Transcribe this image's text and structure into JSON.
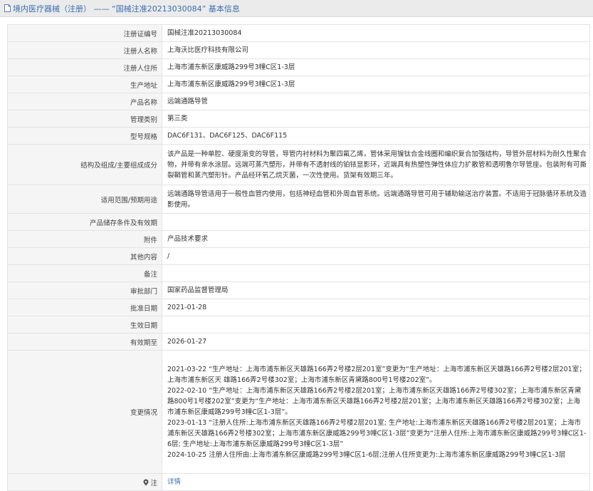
{
  "header": {
    "title": "境内医疗器械（注册） —— “国械注准20213030084” 基本信息"
  },
  "rows": [
    {
      "label": "注册证编号",
      "value": "国械注准20213030084"
    },
    {
      "label": "注册人名称",
      "value": "上海沃比医疗科技有限公司"
    },
    {
      "label": "注册人住所",
      "value": "上海市浦东新区康威路299号3幢C区1-3层"
    },
    {
      "label": "生产地址",
      "value": "上海市浦东新区康威路299号3幢C区1-3层"
    },
    {
      "label": "产品名称",
      "value": "远端通路导管"
    },
    {
      "label": "管理类别",
      "value": "第三类"
    },
    {
      "label": "型号规格",
      "value": "DAC6F131、DAC6F125、DAC6F115"
    },
    {
      "label": "结构及组成/主要组成成分",
      "value": "该产品是一种单腔、硬度渐变的导管，导管内衬材料为聚四氟乙烯，管体采用镍钛合金线圈和编织复合加强结构，导管外层材料为耐久性聚合物，并带有亲水涂层。远端可蒸汽塑形，并带有不透射线的铂铱显影环，近端具有热塑性弹性体应力扩散管和透明鲁尔导管座。包装附有可撕裂鞘管和蒸汽塑形针。产品经环氧乙烷灭菌，一次性使用。货架有效期三年。"
    },
    {
      "label": "适用范围/预期用途",
      "value": "远端通路导管适用于一般性血管内使用，包括神经血管和外周血管系统。远端通路导管可用于辅助输送治疗装置。不适用于冠脉循环系统及造影使用。"
    },
    {
      "label": "产品储存条件及有效期",
      "value": ""
    },
    {
      "label": "附件",
      "value": "产品技术要求"
    },
    {
      "label": "其他内容",
      "value": "/"
    },
    {
      "label": "备注",
      "value": ""
    },
    {
      "label": "审批部门",
      "value": "国家药品监督管理局"
    },
    {
      "label": "批准日期",
      "value": "2021-01-28"
    },
    {
      "label": "生效日期",
      "value": ""
    },
    {
      "label": "有效期至",
      "value": "2026-01-27"
    }
  ],
  "changes": {
    "label": "变更情况",
    "lines": [
      "2021-03-22 “生产地址：上海市浦东新区天雄路166弄2号楼2层201室”变更为“生产地址：上海市浦东新区天雄路166弄2号楼2层201室；上海市浦东新区天 雄路166弄2号楼302室；上海市浦东新区青黛路800号1号楼202室”。",
      "2022-02-10 “生产地址：上海市浦东新区天雄路166弄2号楼2层201室；上海市浦东新区天雄路166弄2号楼302室；上海市浦东新区青黛路800号1号楼202室”变更为“生产地址：上海市浦东新区天雄路166弄2号楼2层201室；上海市浦东新区天雄路166弄2号楼302室；上海市浦东新区康威路299号3幢C区1-3层”。",
      "2023-01-13 “注册人住所:上海市浦东新区天雄路166弄2号楼2层201室; 生产地址:上海市浦东新区天雄路166弄2号楼2层201室；上海市浦东新区天雄路166弄2号楼302室；上海市浦东新区康威路299号3幢C区1-3层”变更为“注册人住所:上海市浦东新区康威路299号3幢C区1-6层; 生产地址:上海市浦东新区康威路299号3幢C区1-3层”",
      "2024-10-25 注册人住所由:上海市浦东新区康威路299号3幢C区1-6层;注册人住所变更为:上海市浦东新区康威路299号3幢C区1-3层"
    ]
  },
  "footer": {
    "label": "注",
    "link": "详情",
    "icon": "location-pin-icon"
  }
}
